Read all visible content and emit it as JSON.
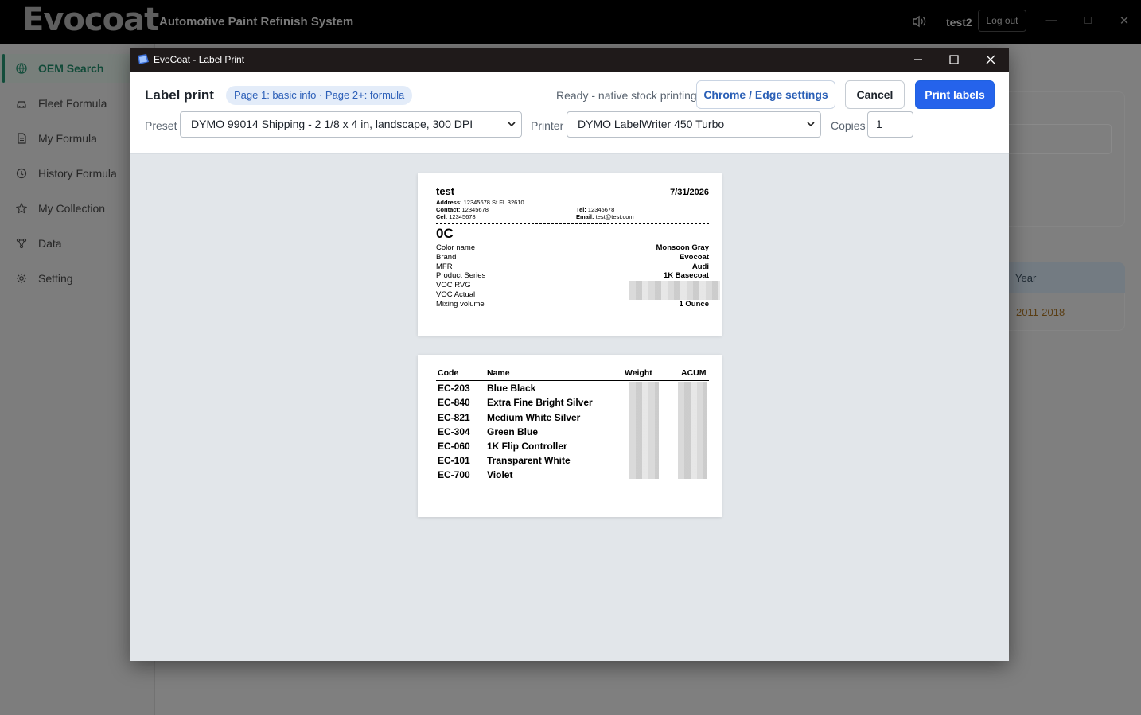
{
  "app": {
    "logo": "Evocoat",
    "tagline": "Automotive Paint Refinish System",
    "user": "test2",
    "logout_label": "Log out",
    "accent_color": "#134d3b"
  },
  "sidebar": {
    "items": [
      {
        "label": "OEM Search",
        "icon": "globe-icon",
        "active": true
      },
      {
        "label": "Fleet Formula",
        "icon": "car-icon"
      },
      {
        "label": "My Formula",
        "icon": "document-icon"
      },
      {
        "label": "History Formula",
        "icon": "history-icon"
      },
      {
        "label": "My Collection",
        "icon": "star-icon"
      },
      {
        "label": "Data",
        "icon": "branch-icon"
      },
      {
        "label": "Setting",
        "icon": "gear-icon"
      }
    ]
  },
  "background_table": {
    "header": "Year",
    "row_value": "2011-2018"
  },
  "dialog": {
    "title": "EvoCoat - Label Print",
    "heading": "Label print",
    "pages_hint": "Page 1: basic info · Page 2+: formula",
    "status": "Ready - native stock printing",
    "chrome_edge_label": "Chrome / Edge settings",
    "cancel_label": "Cancel",
    "print_label": "Print labels",
    "print_color": "#2563eb",
    "preset_label": "Preset",
    "preset_value": "DYMO 99014 Shipping - 2 1/8 x 4 in, landscape, 300 DPI",
    "printer_label": "Printer",
    "printer_value": "DYMO LabelWriter 450 Turbo",
    "copies_label": "Copies",
    "copies_value": "1"
  },
  "label1": {
    "shop_name": "test",
    "date": "7/31/2026",
    "address_key": "Address:",
    "address_val": "12345678 St FL 32610",
    "contact_key": "Contact:",
    "contact_val": "12345678",
    "cel_key": "Cel:",
    "cel_val": "12345678",
    "tel_key": "Tel:",
    "tel_val": "12345678",
    "email_key": "Email:",
    "email_val": "test@test.com",
    "color_code": "0C",
    "rows": [
      {
        "key": "Color name",
        "value": "Monsoon Gray"
      },
      {
        "key": "Brand",
        "value": "Evocoat"
      },
      {
        "key": "MFR",
        "value": "Audi"
      },
      {
        "key": "Product Series",
        "value": "1K Basecoat"
      },
      {
        "key": "VOC RVG",
        "value": ""
      },
      {
        "key": "VOC Actual",
        "value": ""
      },
      {
        "key": "Mixing volume",
        "value": "1 Ounce"
      }
    ]
  },
  "label2": {
    "headers": {
      "code": "Code",
      "name": "Name",
      "weight": "Weight",
      "acum": "ACUM"
    },
    "rows": [
      {
        "code": "EC-203",
        "name": "Blue Black"
      },
      {
        "code": "EC-840",
        "name": "Extra Fine Bright Silver"
      },
      {
        "code": "EC-821",
        "name": "Medium White Silver"
      },
      {
        "code": "EC-304",
        "name": "Green Blue"
      },
      {
        "code": "EC-060",
        "name": "1K Flip Controller"
      },
      {
        "code": "EC-101",
        "name": "Transparent White"
      },
      {
        "code": "EC-700",
        "name": "Violet"
      }
    ]
  }
}
